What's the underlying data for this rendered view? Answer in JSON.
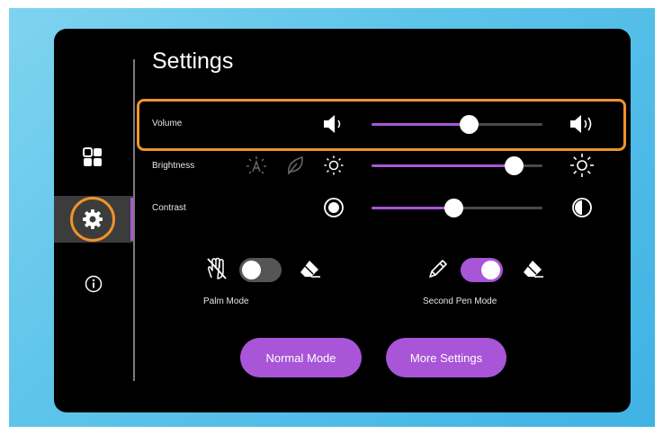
{
  "page": {
    "title": "Settings"
  },
  "sidebar": {
    "items": [
      {
        "name": "apps",
        "icon": "apps-grid-icon"
      },
      {
        "name": "settings",
        "icon": "gear-icon",
        "active": true
      },
      {
        "name": "info",
        "icon": "info-icon"
      }
    ]
  },
  "rows": {
    "volume": {
      "label": "Volume",
      "value": 0.57,
      "icon_min": "speaker-low-icon",
      "icon_max": "speaker-high-icon"
    },
    "brightness": {
      "label": "Brightness",
      "value": 0.83,
      "auto_icon": "auto-brightness-icon",
      "eco_icon": "leaf-icon",
      "icon_min": "sun-low-icon",
      "icon_max": "sun-high-icon"
    },
    "contrast": {
      "label": "Contrast",
      "value": 0.48,
      "icon_min": "contrast-low-icon",
      "icon_max": "contrast-high-icon"
    }
  },
  "toggles": {
    "palm_mode": {
      "label": "Palm Mode",
      "on": false,
      "left_icon": "palm-icon",
      "right_icon": "eraser-icon"
    },
    "second_pen_mode": {
      "label": "Second Pen Mode",
      "on": true,
      "left_icon": "pen-icon",
      "right_icon": "eraser-icon"
    }
  },
  "buttons": {
    "normal_mode": "Normal Mode",
    "more_settings": "More Settings"
  },
  "colors": {
    "accent": "#a855d8",
    "highlight": "#f0932a",
    "panel": "#000000",
    "track": "#4a4a4a"
  }
}
